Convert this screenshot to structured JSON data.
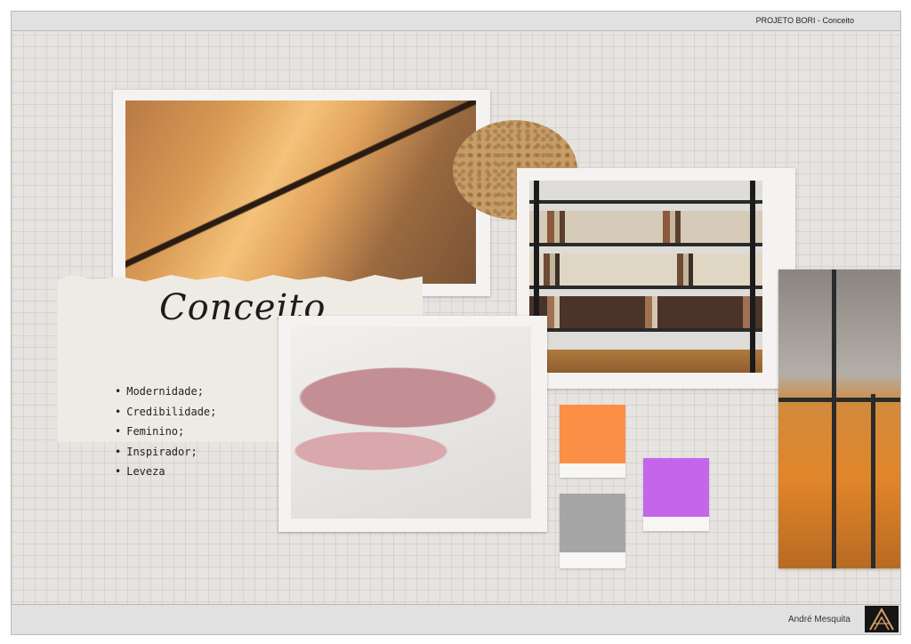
{
  "header": {
    "title": "PROJETO BORI - Conceito"
  },
  "footer": {
    "author": "André Mesquita",
    "logo_icon": "monogram-logo-icon"
  },
  "moodboard": {
    "heading": "Conceito",
    "keywords": [
      "Modernidade;",
      "Credibilidade;",
      "Feminino;",
      "Inspirador;",
      "Leveza"
    ]
  },
  "palette": {
    "orange": "#fa8f45",
    "violet": "#c466ea",
    "gray": "#a7a6a6"
  }
}
